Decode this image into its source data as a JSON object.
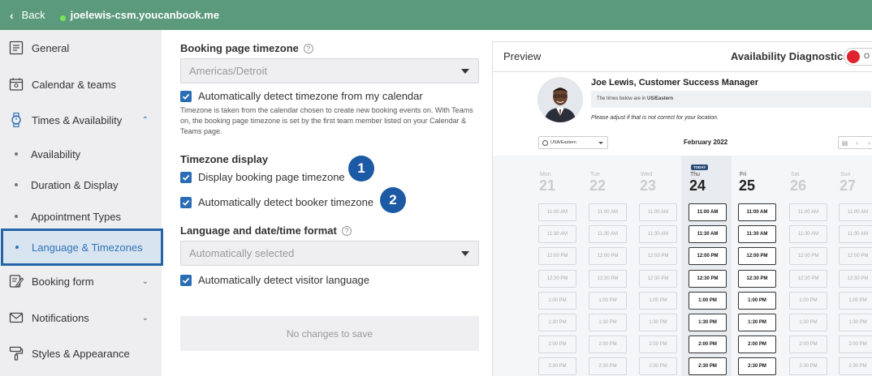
{
  "topbar": {
    "back_label": "Back",
    "domain": "joelewis-csm.youcanbook.me"
  },
  "sidebar": {
    "general": "General",
    "calendar": "Calendar & teams",
    "times": "Times & Availability",
    "sub": [
      "Availability",
      "Duration & Display",
      "Appointment Types",
      "Language & Timezones"
    ],
    "booking_form": "Booking form",
    "notifications": "Notifications",
    "styles": "Styles & Appearance"
  },
  "settings": {
    "tz_label": "Booking page timezone",
    "tz_value": "Americas/Detroit",
    "tz_auto": "Automatically detect timezone from my calendar",
    "tz_note": "Timezone is taken from the calendar chosen to create new booking events on. With Teams on, the booking page timezone is set by the first team member listed on your Calendar & Teams page.",
    "tz_display_label": "Timezone display",
    "display_tz": "Display booking page timezone",
    "booker_tz": "Automatically detect booker timezone",
    "lang_label": "Language and date/time format",
    "lang_value": "Automatically selected",
    "lang_auto": "Automatically detect visitor language",
    "save": "No changes to save",
    "badge1": "1",
    "badge2": "2"
  },
  "preview": {
    "title": "Preview",
    "diagnostics": "Availability Diagnostics",
    "toggle_text": "O",
    "host": "Joe Lewis, Customer Success Manager",
    "tz_note_pre": "The times below are in ",
    "tz_note_zone": "US/Eastern",
    "adjust": "Please adjust if that is not correct for your location.",
    "tz_select": "USA/Eastern",
    "month": "February 2022",
    "today_tag": "TODAY",
    "days": [
      {
        "name": "Mon",
        "num": "21"
      },
      {
        "name": "Tue",
        "num": "22"
      },
      {
        "name": "Wed",
        "num": "23"
      },
      {
        "name": "Thu",
        "num": "24"
      },
      {
        "name": "Fri",
        "num": "25"
      },
      {
        "name": "Sat",
        "num": "26"
      },
      {
        "name": "Sun",
        "num": "27"
      }
    ],
    "times": [
      "11:00 AM",
      "11:30 AM",
      "12:00 PM",
      "12:30 PM",
      "1:00 PM",
      "1:30 PM",
      "2:00 PM",
      "2:30 PM"
    ]
  },
  "colors": {
    "topbar": "#5b9a7c",
    "accent": "#2a6db4",
    "badge": "#1d5aa5"
  }
}
